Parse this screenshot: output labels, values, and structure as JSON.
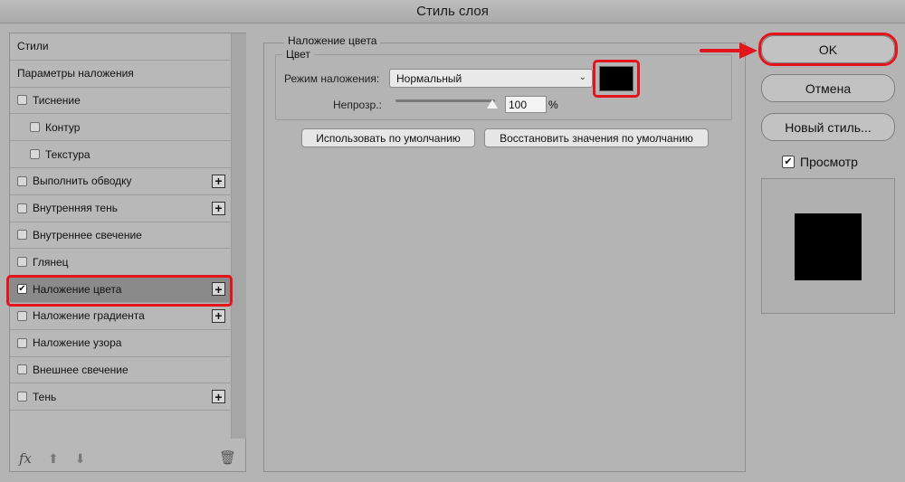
{
  "window": {
    "title": "Стиль слоя"
  },
  "styles_list": {
    "items": [
      {
        "label": "Стили",
        "checkbox": false,
        "checked": false,
        "indent": false,
        "plus": false
      },
      {
        "label": "Параметры наложения",
        "checkbox": false,
        "checked": false,
        "indent": false,
        "plus": false
      },
      {
        "label": "Тиснение",
        "checkbox": true,
        "checked": false,
        "indent": false,
        "plus": false
      },
      {
        "label": "Контур",
        "checkbox": true,
        "checked": false,
        "indent": true,
        "plus": false
      },
      {
        "label": "Текстура",
        "checkbox": true,
        "checked": false,
        "indent": true,
        "plus": false
      },
      {
        "label": "Выполнить обводку",
        "checkbox": true,
        "checked": false,
        "indent": false,
        "plus": true
      },
      {
        "label": "Внутренняя тень",
        "checkbox": true,
        "checked": false,
        "indent": false,
        "plus": true
      },
      {
        "label": "Внутреннее свечение",
        "checkbox": true,
        "checked": false,
        "indent": false,
        "plus": false
      },
      {
        "label": "Глянец",
        "checkbox": true,
        "checked": false,
        "indent": false,
        "plus": false
      },
      {
        "label": "Наложение цвета",
        "checkbox": true,
        "checked": true,
        "indent": false,
        "plus": true,
        "selected": true
      },
      {
        "label": "Наложение градиента",
        "checkbox": true,
        "checked": false,
        "indent": false,
        "plus": true
      },
      {
        "label": "Наложение узора",
        "checkbox": true,
        "checked": false,
        "indent": false,
        "plus": false
      },
      {
        "label": "Внешнее свечение",
        "checkbox": true,
        "checked": false,
        "indent": false,
        "plus": false
      },
      {
        "label": "Тень",
        "checkbox": true,
        "checked": false,
        "indent": false,
        "plus": true
      }
    ],
    "footer": {
      "fx": "fx",
      "icons": [
        "fx-icon",
        "arrow-up-icon",
        "arrow-down-icon",
        "trash-icon"
      ]
    }
  },
  "color_overlay": {
    "section_title": "Наложение цвета",
    "group_title": "Цвет",
    "blend_mode_label": "Режим наложения:",
    "blend_mode_value": "Нормальный",
    "color": "#000000",
    "opacity_label": "Непрозр.:",
    "opacity_value": "100",
    "opacity_fraction": 1.0,
    "percent_sign": "%",
    "make_default": "Использовать по умолчанию",
    "reset_default": "Восстановить значения по умолчанию"
  },
  "actions": {
    "ok": "OK",
    "cancel": "Отмена",
    "new_style": "Новый стиль...",
    "preview_label": "Просмотр",
    "preview_checked": true
  },
  "colors": {
    "highlight": "#e3141b",
    "selected_row": "#8a8a8a",
    "background": "#b4b4b4"
  }
}
